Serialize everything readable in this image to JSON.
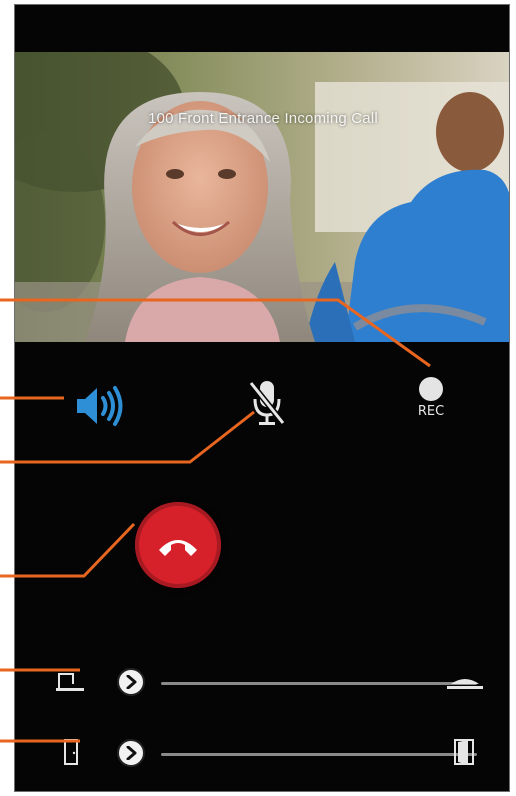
{
  "call": {
    "title": "100 Front Entrance Incoming Call"
  },
  "controls": {
    "rec_label": "REC"
  },
  "icons": {
    "speaker": "speaker-volume-icon",
    "mute": "microphone-muted-icon",
    "record": "record-dot-icon",
    "hangup": "phone-hangup-icon",
    "gate_closed": "gate-closed-icon",
    "gate_open": "gate-open-icon",
    "door_closed": "door-closed-icon",
    "door_open": "door-open-icon",
    "slider_arrow": "chevron-right-icon"
  },
  "colors": {
    "speaker_active": "#2e8fd6",
    "hangup": "#d6212a",
    "callout": "#e8661f",
    "background": "#050505"
  }
}
